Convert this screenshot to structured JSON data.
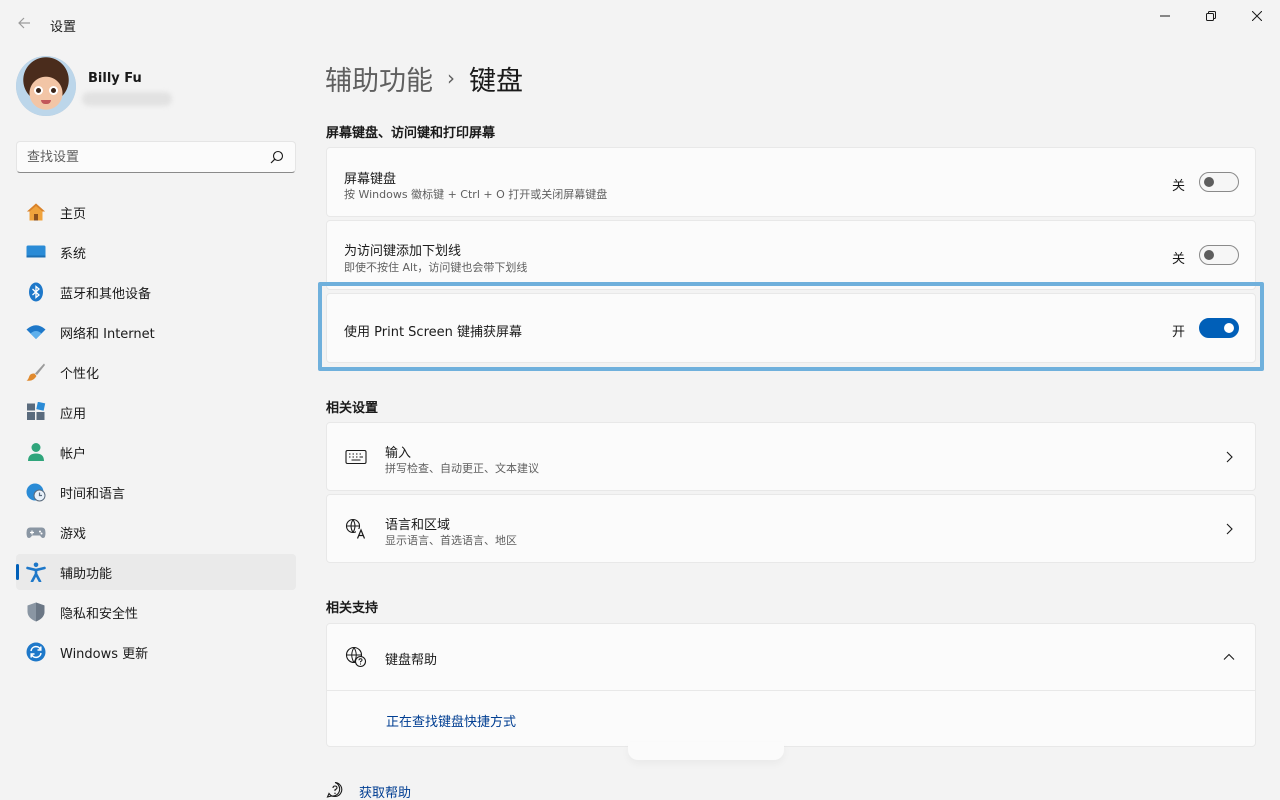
{
  "window": {
    "title": "设置"
  },
  "profile": {
    "name": "Billy Fu"
  },
  "search": {
    "placeholder": "查找设置"
  },
  "sidebar": {
    "items": [
      {
        "label": "主页",
        "icon": "home-icon"
      },
      {
        "label": "系统",
        "icon": "monitor-icon"
      },
      {
        "label": "蓝牙和其他设备",
        "icon": "bluetooth-icon"
      },
      {
        "label": "网络和 Internet",
        "icon": "wifi-icon"
      },
      {
        "label": "个性化",
        "icon": "brush-icon"
      },
      {
        "label": "应用",
        "icon": "apps-icon"
      },
      {
        "label": "帐户",
        "icon": "person-icon"
      },
      {
        "label": "时间和语言",
        "icon": "globe-clock-icon"
      },
      {
        "label": "游戏",
        "icon": "gamepad-icon"
      },
      {
        "label": "辅助功能",
        "icon": "accessibility-icon",
        "active": true
      },
      {
        "label": "隐私和安全性",
        "icon": "shield-icon"
      },
      {
        "label": "Windows 更新",
        "icon": "update-icon"
      }
    ]
  },
  "breadcrumb": {
    "parent": "辅助功能",
    "separator": "›",
    "current": "键盘"
  },
  "section_keyboard": {
    "title": "屏幕键盘、访问键和打印屏幕",
    "items": [
      {
        "title": "屏幕键盘",
        "subtitle": "按 Windows 徽标键 + Ctrl + O 打开或关闭屏幕键盘",
        "state_label": "关",
        "on": false
      },
      {
        "title": "为访问键添加下划线",
        "subtitle": "即使不按住 Alt，访问键也会带下划线",
        "state_label": "关",
        "on": false
      },
      {
        "title": "使用 Print Screen 键捕获屏幕",
        "subtitle": "",
        "state_label": "开",
        "on": true
      }
    ]
  },
  "section_related": {
    "title": "相关设置",
    "items": [
      {
        "title": "输入",
        "subtitle": "拼写检查、自动更正、文本建议",
        "icon": "keyboard-icon"
      },
      {
        "title": "语言和区域",
        "subtitle": "显示语言、首选语言、地区",
        "icon": "language-icon"
      }
    ]
  },
  "section_support": {
    "title": "相关支持",
    "help_title": "键盘帮助",
    "help_link": "正在查找键盘快捷方式"
  },
  "footer": {
    "get_help": "获取帮助"
  },
  "colors": {
    "accent": "#005fb8",
    "highlight": "#6fb0dc",
    "link": "#003e92"
  }
}
